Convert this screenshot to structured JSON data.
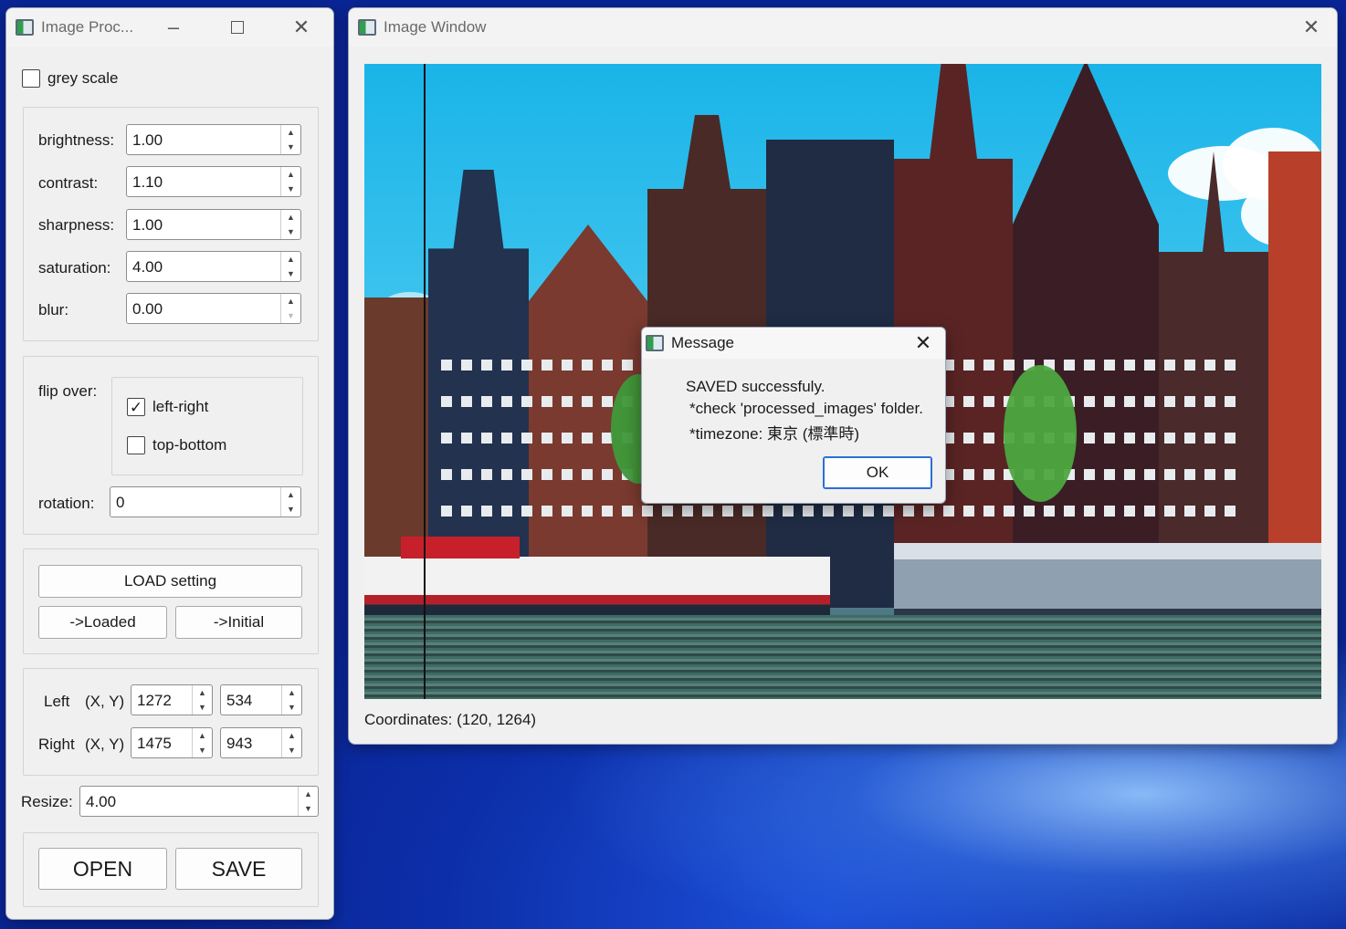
{
  "panel": {
    "title": "Image Proc...",
    "greyscale_label": "grey scale",
    "greyscale_checked": false,
    "adjust": [
      {
        "label": "brightness:",
        "value": "1.00"
      },
      {
        "label": "contrast:",
        "value": "1.10"
      },
      {
        "label": "sharpness:",
        "value": "1.00"
      },
      {
        "label": "saturation:",
        "value": "4.00"
      },
      {
        "label": "blur:",
        "value": "0.00"
      }
    ],
    "flip_label": "flip over:",
    "flip_left_right_label": "left-right",
    "flip_left_right_checked": true,
    "flip_top_bottom_label": "top-bottom",
    "flip_top_bottom_checked": false,
    "rotation_label": "rotation:",
    "rotation_value": "0",
    "load_setting_label": "LOAD setting",
    "to_loaded_label": "->Loaded",
    "to_initial_label": "->Initial",
    "left_label": "Left",
    "right_label": "Right",
    "xy_label": "(X, Y)",
    "left_x": "1272",
    "left_y": "534",
    "right_x": "1475",
    "right_y": "943",
    "resize_label": "Resize:",
    "resize_value": "4.00",
    "open_label": "OPEN",
    "save_label": "SAVE"
  },
  "image_window": {
    "title": "Image Window",
    "coordinates": "Coordinates: (120, 1264)"
  },
  "message": {
    "title": "Message",
    "line1": "SAVED successfuly.",
    "line2": "*check 'processed_images' folder.",
    "line3": "*timezone: 東京 (標準時)",
    "ok_label": "OK"
  },
  "colors": {
    "accent": "#2b6fd6",
    "window_bg": "#f0f0f0",
    "desktop": "#0b2ca0"
  },
  "icons": [
    "app-icon",
    "minimize-icon",
    "maximize-icon",
    "close-icon",
    "checkmark-icon",
    "spin-up-icon",
    "spin-down-icon"
  ]
}
